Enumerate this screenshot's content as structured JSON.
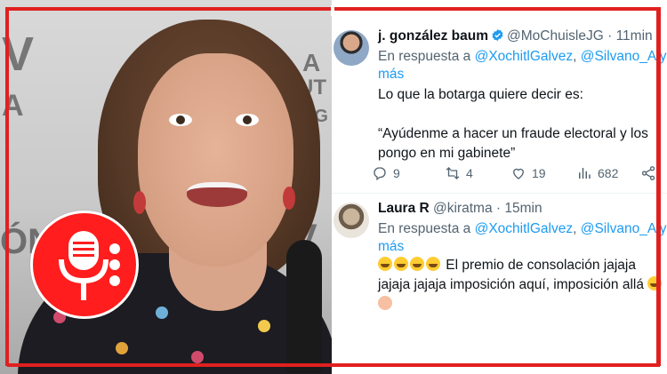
{
  "tweets": [
    {
      "name": "j. gonzález baum",
      "verified": true,
      "handle": "@MoChuisleJG",
      "time": "11min",
      "reply_prefix": "En respuesta a ",
      "reply_mention_1": "@XochitlGalvez",
      "reply_sep": ", ",
      "reply_mention_2": "@Silvano_A",
      "reply_suffix": " y",
      "reply_more": "más",
      "text_p1": "Lo que la botarga quiere decir es:",
      "text_p2": "“Ayúdenme a hacer un fraude electoral y los pongo en mi gabinete”",
      "replies": "9",
      "retweets": "4",
      "likes": "19",
      "views": "682"
    },
    {
      "name": "Laura R",
      "handle": "@kiratma",
      "time": "15min",
      "reply_prefix": "En respuesta a ",
      "reply_mention_1": "@XochitlGalvez",
      "reply_sep": ", ",
      "reply_mention_2": "@Silvano_A",
      "reply_suffix": " y",
      "reply_more": "más",
      "emoji": "😂",
      "emoji_end": "🤦‍♀️",
      "text": " El premio de consolación jajaja jajaja jajaja imposición aquí, imposición allá"
    }
  ],
  "icons": {
    "verified": "verified-badge-icon",
    "reply": "reply-icon",
    "retweet": "retweet-icon",
    "like": "heart-icon",
    "views": "views-icon",
    "share": "share-icon",
    "mic": "microphone-icon"
  },
  "colors": {
    "frame": "#e0201f",
    "badge": "#ff1d1d",
    "link": "#1d9bf0",
    "muted": "#536471",
    "text": "#0f1419"
  }
}
